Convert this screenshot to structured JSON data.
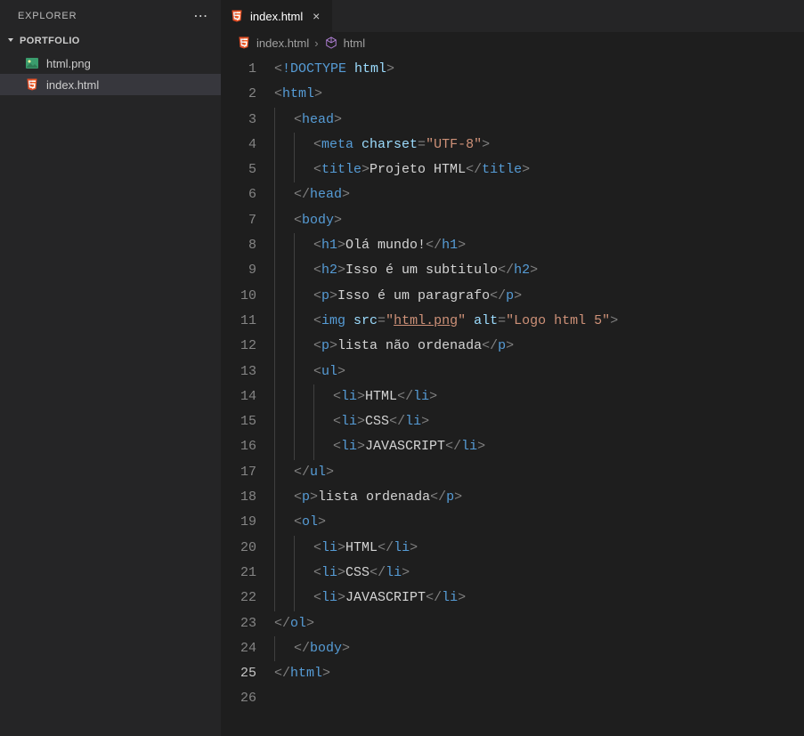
{
  "sidebar": {
    "explorer_label": "EXPLORER",
    "more_actions": "⋯",
    "folder": "PORTFOLIO",
    "files": [
      {
        "name": "html.png",
        "icon": "image-file-icon",
        "selected": false
      },
      {
        "name": "index.html",
        "icon": "html5-icon",
        "selected": true
      }
    ]
  },
  "tabs": [
    {
      "icon": "html5-icon",
      "label": "index.html",
      "close": "×"
    }
  ],
  "breadcrumb": {
    "file_icon": "html5-icon",
    "file": "index.html",
    "sep": "›",
    "symbol_icon": "box-icon",
    "symbol": "html"
  },
  "editor": {
    "active_line": 25,
    "lines": [
      {
        "n": 1,
        "indent": 0,
        "tokens": [
          [
            "brk",
            "<"
          ],
          [
            "doc",
            "!DOCTYPE "
          ],
          [
            "attr",
            "html"
          ],
          [
            "brk",
            ">"
          ]
        ]
      },
      {
        "n": 2,
        "indent": 0,
        "tokens": [
          [
            "brk",
            "<"
          ],
          [
            "tag",
            "html"
          ],
          [
            "brk",
            ">"
          ]
        ]
      },
      {
        "n": 3,
        "indent": 1,
        "tokens": [
          [
            "brk",
            "<"
          ],
          [
            "tag",
            "head"
          ],
          [
            "brk",
            ">"
          ]
        ]
      },
      {
        "n": 4,
        "indent": 2,
        "tokens": [
          [
            "brk",
            "<"
          ],
          [
            "tag",
            "meta "
          ],
          [
            "attr",
            "charset"
          ],
          [
            "brk",
            "="
          ],
          [
            "str",
            "\"UTF-8\""
          ],
          [
            "brk",
            ">"
          ]
        ]
      },
      {
        "n": 5,
        "indent": 2,
        "tokens": [
          [
            "brk",
            "<"
          ],
          [
            "tag",
            "title"
          ],
          [
            "brk",
            ">"
          ],
          [
            "txt",
            "Projeto HTML"
          ],
          [
            "brk",
            "</"
          ],
          [
            "tag",
            "title"
          ],
          [
            "brk",
            ">"
          ]
        ]
      },
      {
        "n": 6,
        "indent": 1,
        "tokens": [
          [
            "brk",
            "</"
          ],
          [
            "tag",
            "head"
          ],
          [
            "brk",
            ">"
          ]
        ]
      },
      {
        "n": 7,
        "indent": 1,
        "tokens": [
          [
            "brk",
            "<"
          ],
          [
            "tag",
            "body"
          ],
          [
            "brk",
            ">"
          ]
        ]
      },
      {
        "n": 8,
        "indent": 2,
        "tokens": [
          [
            "brk",
            "<"
          ],
          [
            "tag",
            "h1"
          ],
          [
            "brk",
            ">"
          ],
          [
            "txt",
            "Olá mundo!"
          ],
          [
            "brk",
            "</"
          ],
          [
            "tag",
            "h1"
          ],
          [
            "brk",
            ">"
          ]
        ]
      },
      {
        "n": 9,
        "indent": 2,
        "tokens": [
          [
            "brk",
            "<"
          ],
          [
            "tag",
            "h2"
          ],
          [
            "brk",
            ">"
          ],
          [
            "txt",
            "Isso é um subtitulo"
          ],
          [
            "brk",
            "</"
          ],
          [
            "tag",
            "h2"
          ],
          [
            "brk",
            ">"
          ]
        ]
      },
      {
        "n": 10,
        "indent": 2,
        "tokens": [
          [
            "brk",
            "<"
          ],
          [
            "tag",
            "p"
          ],
          [
            "brk",
            ">"
          ],
          [
            "txt",
            "Isso é um paragrafo"
          ],
          [
            "brk",
            "</"
          ],
          [
            "tag",
            "p"
          ],
          [
            "brk",
            ">"
          ]
        ]
      },
      {
        "n": 11,
        "indent": 2,
        "tokens": [
          [
            "brk",
            "<"
          ],
          [
            "tag",
            "img "
          ],
          [
            "attr",
            "src"
          ],
          [
            "brk",
            "="
          ],
          [
            "str",
            "\""
          ],
          [
            "link",
            "html.png"
          ],
          [
            "str",
            "\""
          ],
          [
            "txt",
            " "
          ],
          [
            "attr",
            "alt"
          ],
          [
            "brk",
            "="
          ],
          [
            "str",
            "\"Logo html 5\""
          ],
          [
            "brk",
            ">"
          ]
        ]
      },
      {
        "n": 12,
        "indent": 2,
        "tokens": [
          [
            "brk",
            "<"
          ],
          [
            "tag",
            "p"
          ],
          [
            "brk",
            ">"
          ],
          [
            "txt",
            "lista não ordenada"
          ],
          [
            "brk",
            "</"
          ],
          [
            "tag",
            "p"
          ],
          [
            "brk",
            ">"
          ]
        ]
      },
      {
        "n": 13,
        "indent": 2,
        "tokens": [
          [
            "brk",
            "<"
          ],
          [
            "tag",
            "ul"
          ],
          [
            "brk",
            ">"
          ]
        ]
      },
      {
        "n": 14,
        "indent": 3,
        "tokens": [
          [
            "brk",
            "<"
          ],
          [
            "tag",
            "li"
          ],
          [
            "brk",
            ">"
          ],
          [
            "txt",
            "HTML"
          ],
          [
            "brk",
            "</"
          ],
          [
            "tag",
            "li"
          ],
          [
            "brk",
            ">"
          ]
        ]
      },
      {
        "n": 15,
        "indent": 3,
        "tokens": [
          [
            "brk",
            "<"
          ],
          [
            "tag",
            "li"
          ],
          [
            "brk",
            ">"
          ],
          [
            "txt",
            "CSS"
          ],
          [
            "brk",
            "</"
          ],
          [
            "tag",
            "li"
          ],
          [
            "brk",
            ">"
          ]
        ]
      },
      {
        "n": 16,
        "indent": 3,
        "tokens": [
          [
            "brk",
            "<"
          ],
          [
            "tag",
            "li"
          ],
          [
            "brk",
            ">"
          ],
          [
            "txt",
            "JAVASCRIPT"
          ],
          [
            "brk",
            "</"
          ],
          [
            "tag",
            "li"
          ],
          [
            "brk",
            ">"
          ]
        ]
      },
      {
        "n": 17,
        "indent": 1,
        "tokens": [
          [
            "brk",
            "</"
          ],
          [
            "tag",
            "ul"
          ],
          [
            "brk",
            ">"
          ]
        ]
      },
      {
        "n": 18,
        "indent": 1,
        "tokens": [
          [
            "brk",
            "<"
          ],
          [
            "tag",
            "p"
          ],
          [
            "brk",
            ">"
          ],
          [
            "txt",
            "lista ordenada"
          ],
          [
            "brk",
            "</"
          ],
          [
            "tag",
            "p"
          ],
          [
            "brk",
            ">"
          ]
        ]
      },
      {
        "n": 19,
        "indent": 1,
        "tokens": [
          [
            "brk",
            "<"
          ],
          [
            "tag",
            "ol"
          ],
          [
            "brk",
            ">"
          ]
        ]
      },
      {
        "n": 20,
        "indent": 2,
        "tokens": [
          [
            "brk",
            "<"
          ],
          [
            "tag",
            "li"
          ],
          [
            "brk",
            ">"
          ],
          [
            "txt",
            "HTML"
          ],
          [
            "brk",
            "</"
          ],
          [
            "tag",
            "li"
          ],
          [
            "brk",
            ">"
          ]
        ]
      },
      {
        "n": 21,
        "indent": 2,
        "tokens": [
          [
            "brk",
            "<"
          ],
          [
            "tag",
            "li"
          ],
          [
            "brk",
            ">"
          ],
          [
            "txt",
            "CSS"
          ],
          [
            "brk",
            "</"
          ],
          [
            "tag",
            "li"
          ],
          [
            "brk",
            ">"
          ]
        ]
      },
      {
        "n": 22,
        "indent": 2,
        "tokens": [
          [
            "brk",
            "<"
          ],
          [
            "tag",
            "li"
          ],
          [
            "brk",
            ">"
          ],
          [
            "txt",
            "JAVASCRIPT"
          ],
          [
            "brk",
            "</"
          ],
          [
            "tag",
            "li"
          ],
          [
            "brk",
            ">"
          ]
        ]
      },
      {
        "n": 23,
        "indent": 0,
        "tokens": [
          [
            "brk",
            "</"
          ],
          [
            "tag",
            "ol"
          ],
          [
            "brk",
            ">"
          ]
        ]
      },
      {
        "n": 24,
        "indent": 1,
        "tokens": [
          [
            "brk",
            "</"
          ],
          [
            "tag",
            "body"
          ],
          [
            "brk",
            ">"
          ]
        ]
      },
      {
        "n": 25,
        "indent": 0,
        "tokens": [
          [
            "brk",
            "</"
          ],
          [
            "tag",
            "html"
          ],
          [
            "brk",
            ">"
          ]
        ]
      },
      {
        "n": 26,
        "indent": 0,
        "tokens": []
      }
    ]
  }
}
